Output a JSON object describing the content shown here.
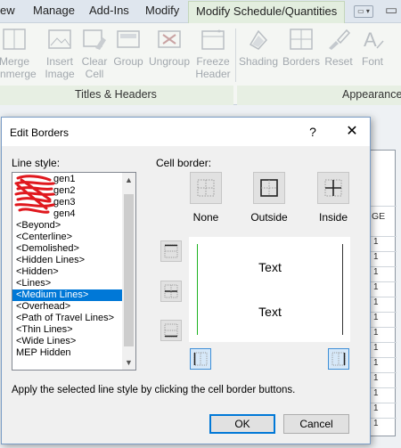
{
  "ribbon": {
    "tabs": [
      "ew",
      "Manage",
      "Add-Ins",
      "Modify",
      "Modify Schedule/Quantities"
    ],
    "buttons": {
      "merge": [
        "Merge",
        "Unmerge"
      ],
      "insert_image": [
        "Insert",
        "Image"
      ],
      "clear_cell": [
        "Clear",
        "Cell"
      ],
      "group": [
        "Group"
      ],
      "ungroup": [
        "Ungroup"
      ],
      "freeze_header": [
        "Freeze",
        "Header"
      ],
      "shading": [
        "Shading"
      ],
      "borders": [
        "Borders"
      ],
      "reset": [
        "Reset"
      ],
      "font": [
        "Font"
      ]
    },
    "groups": [
      "Titles & Headers",
      "Appearance"
    ]
  },
  "background_table": {
    "header": "GE",
    "cells": [
      "1",
      "1",
      "1",
      "1",
      "1",
      "1",
      "1",
      "1",
      "1",
      "1",
      "1",
      "1",
      "1"
    ]
  },
  "dialog": {
    "title": "Edit Borders",
    "help": "?",
    "close": "✕",
    "line_style_label": "Line style:",
    "line_styles": [
      "gen1",
      "gen2",
      "gen3",
      "gen4",
      "<Beyond>",
      "<Centerline>",
      "<Demolished>",
      "<Hidden Lines>",
      "<Hidden>",
      "<Lines>",
      "<Medium Lines>",
      "<Overhead>",
      "<Path of Travel Lines>",
      "<Thin Lines>",
      "<Wide Lines>",
      "MEP Hidden"
    ],
    "selected_style": "<Medium Lines>",
    "cell_border_label": "Cell border:",
    "presets": [
      "None",
      "Outside",
      "Inside"
    ],
    "preview_text": [
      "Text",
      "Text"
    ],
    "hint": "Apply the selected line style by clicking the cell border buttons.",
    "ok": "OK",
    "cancel": "Cancel"
  }
}
